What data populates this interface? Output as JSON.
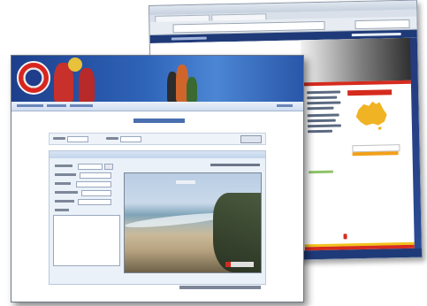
{
  "back_window": {
    "site_title": "",
    "nav_items": [],
    "theme": {
      "chrome": "#c5d0de",
      "nav_blue": "#1f3a78",
      "accent_red": "#d52b1e",
      "accent_yellow": "#f2c21a",
      "map_yellow": "#f0b323"
    },
    "icons": [
      "australia-map-icon"
    ]
  },
  "front_window": {
    "page_title": "",
    "filter_row": {
      "fields": [],
      "button_label": ""
    },
    "form": {
      "header": "",
      "fields": [],
      "textarea_value": ""
    },
    "photo": {
      "subject": "beach-webcam-photo",
      "caption": ""
    },
    "footer_link": "",
    "theme": {
      "header_blue": "#2e63b8",
      "logo_red": "#d8261f",
      "logo_navy": "#1f3d8a",
      "panel": "#eaf1f8"
    },
    "icons": [
      "club-logo-icon"
    ]
  }
}
